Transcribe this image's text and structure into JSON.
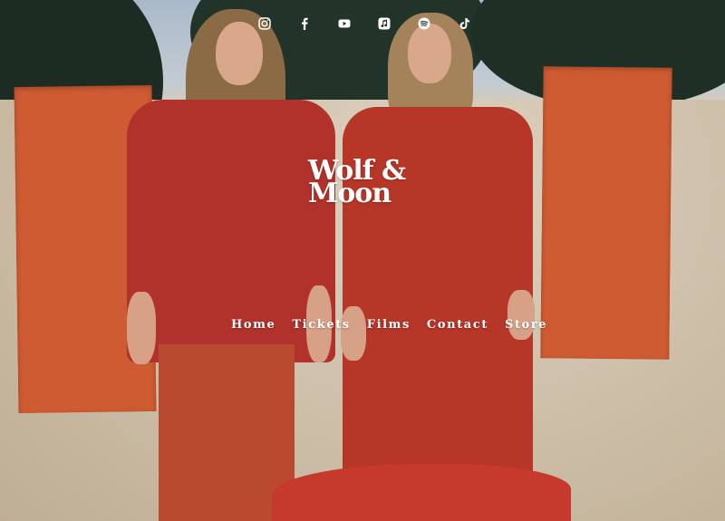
{
  "brand": {
    "logo_line1": "Wolf &",
    "logo_line2": "Moon"
  },
  "social": [
    {
      "name": "instagram-icon",
      "label": "Instagram"
    },
    {
      "name": "facebook-icon",
      "label": "Facebook"
    },
    {
      "name": "youtube-icon",
      "label": "YouTube"
    },
    {
      "name": "apple-music-icon",
      "label": "Apple Music"
    },
    {
      "name": "spotify-icon",
      "label": "Spotify"
    },
    {
      "name": "tiktok-icon",
      "label": "TikTok"
    }
  ],
  "nav": {
    "items": [
      {
        "label": "Home"
      },
      {
        "label": "Tickets"
      },
      {
        "label": "Films"
      },
      {
        "label": "Contact"
      },
      {
        "label": "Store"
      }
    ]
  },
  "colors": {
    "accent": "#b1322a",
    "panel": "#cf5b32",
    "text": "#ffffff"
  }
}
